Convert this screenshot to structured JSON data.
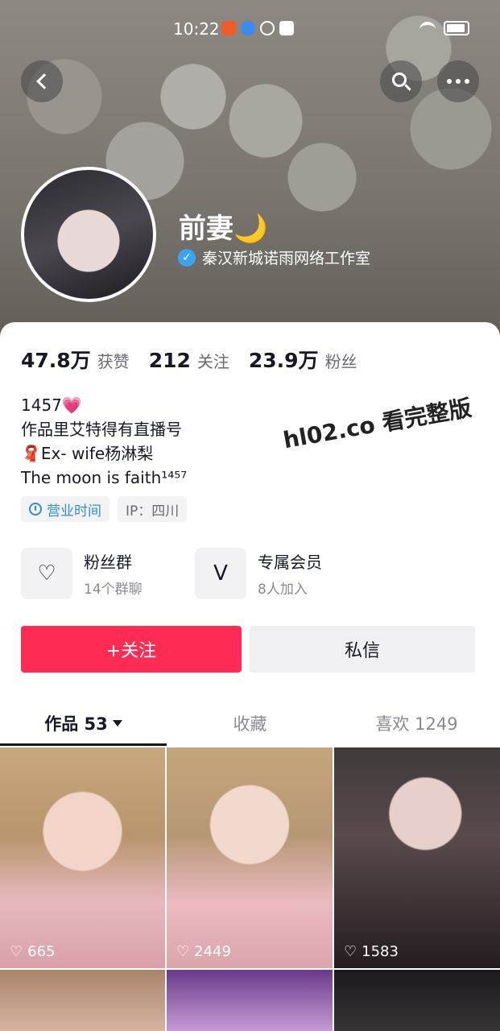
{
  "status": {
    "time": "10:22"
  },
  "profile": {
    "nickname": "前妻🌙",
    "verified_org": "秦汉新城诺雨网络工作室"
  },
  "stats": [
    {
      "value": "47.8万",
      "label": "获赞"
    },
    {
      "value": "212",
      "label": "关注"
    },
    {
      "value": "23.9万",
      "label": "粉丝"
    }
  ],
  "bio": [
    "1457💗",
    "作品里艾特得有直播号",
    "🧣Ex- wife杨淋梨",
    "The moon is faith¹⁴⁵⁷"
  ],
  "tags": {
    "hours": "营业时间",
    "ip": "IP：四川"
  },
  "groups": [
    {
      "title": "粉丝群",
      "sub": "14个群聊",
      "icon": "fan-group-icon"
    },
    {
      "title": "专属会员",
      "sub": "8人加入",
      "icon": "membership-icon"
    }
  ],
  "actions": {
    "follow": "+关注",
    "message": "私信"
  },
  "tabs": [
    {
      "label": "作品 53"
    },
    {
      "label": "收藏"
    },
    {
      "label": "喜欢 1249"
    }
  ],
  "watermark": "hl02.co 看完整版",
  "videos": [
    {
      "likes": "665"
    },
    {
      "likes": "2449"
    },
    {
      "likes": "1583"
    },
    {
      "likes": ""
    },
    {
      "likes": ""
    },
    {
      "likes": ""
    }
  ],
  "colors": {
    "accent": "#fe2c55",
    "verify": "#3aa3f5",
    "link": "#2e8fd8"
  }
}
